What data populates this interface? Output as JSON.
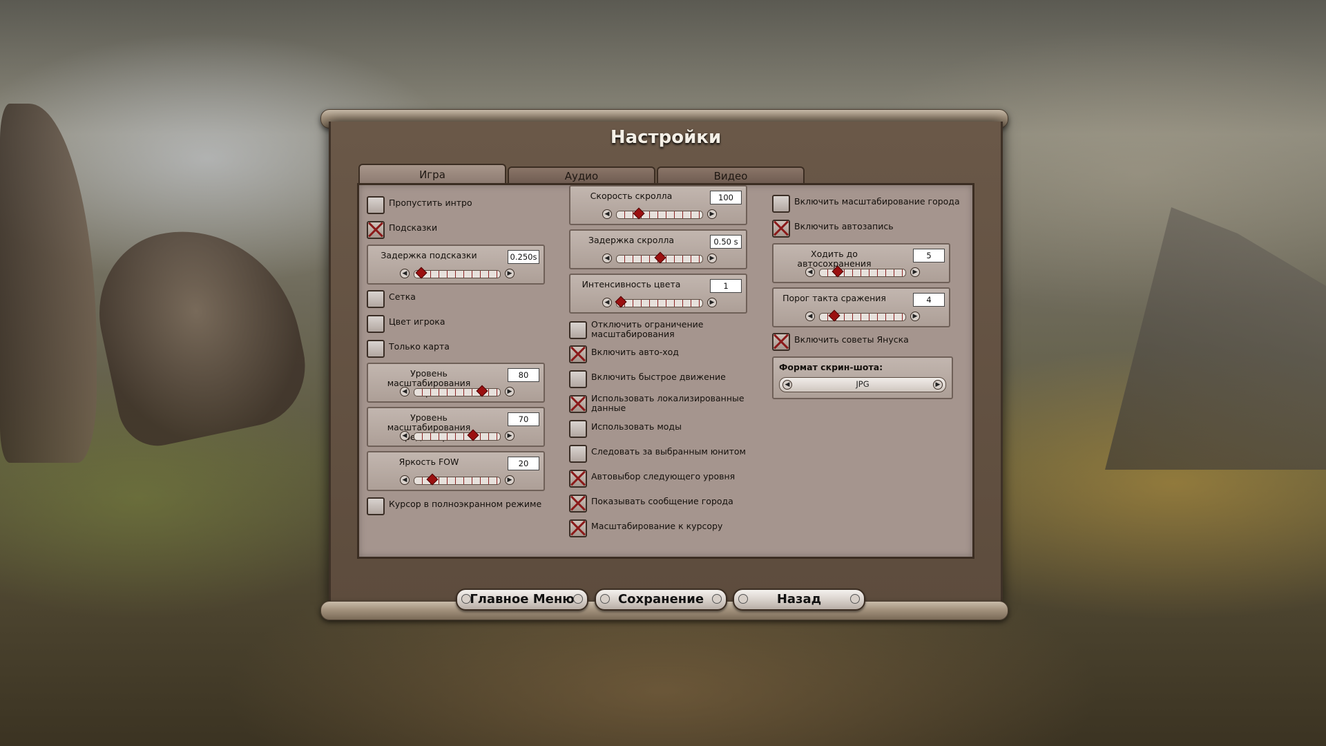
{
  "title": "Настройки",
  "tabs": [
    {
      "label": "Игра",
      "active": true
    },
    {
      "label": "Аудио",
      "active": false
    },
    {
      "label": "Видео",
      "active": false
    }
  ],
  "col1": {
    "skip_intro": {
      "label": "Пропустить интро",
      "checked": false
    },
    "hints": {
      "label": "Подсказки",
      "checked": true
    },
    "hint_delay": {
      "label": "Задержка подсказки",
      "value": "0.250s",
      "level": 0.07
    },
    "grid": {
      "label": "Сетка",
      "checked": false
    },
    "player_color": {
      "label": "Цвет игрока",
      "checked": false
    },
    "map_only": {
      "label": "Только карта",
      "checked": false
    },
    "map_zoom": {
      "label": "Уровень масштабирования карты",
      "value": "80",
      "level": 0.78
    },
    "editor_zoom": {
      "label": "Уровень масштабирования редактора",
      "value": "70",
      "level": 0.68
    },
    "fow_brightness": {
      "label": "Яркость FOW",
      "value": "20",
      "level": 0.2
    },
    "fullscreen_cursor": {
      "label": "Курсор в полноэкранном режиме",
      "checked": false
    }
  },
  "col2": {
    "scroll_speed": {
      "label": "Скорость скролла",
      "value": "100",
      "level": 0.25
    },
    "scroll_delay": {
      "label": "Задержка скролла",
      "value": "0.50 s",
      "level": 0.5
    },
    "color_intensity": {
      "label": "Интенсивность цвета",
      "value": "1",
      "level": 0.04
    },
    "disable_zoom_limit": {
      "label": "Отключить ограничение масштабирования",
      "checked": false
    },
    "auto_move": {
      "label": "Включить авто-ход",
      "checked": true
    },
    "fast_move": {
      "label": "Включить быстрое движение",
      "checked": false
    },
    "localized_data": {
      "label": "Использовать локализированные данные",
      "checked": true
    },
    "use_mods": {
      "label": "Использовать моды",
      "checked": false
    },
    "follow_unit": {
      "label": "Следовать за выбранным юнитом",
      "checked": false
    },
    "auto_next_level": {
      "label": "Автовыбор следующего уровня",
      "checked": true
    },
    "city_message": {
      "label": "Показывать сообщение города",
      "checked": true
    },
    "zoom_to_cursor": {
      "label": "Масштабирование к курсору",
      "checked": true
    }
  },
  "col3": {
    "city_zoom": {
      "label": "Включить масштабирование города",
      "checked": false
    },
    "autosave": {
      "label": "Включить автозапись",
      "checked": true
    },
    "autosave_turns": {
      "label": "Ходить до автосохранения",
      "value": "5",
      "level": 0.2
    },
    "battle_tick": {
      "label": "Порог такта сражения",
      "value": "4",
      "level": 0.16
    },
    "janus_tips": {
      "label": "Включить советы Януска",
      "checked": true
    },
    "screenshot_format": {
      "label": "Формат скрин-шота:",
      "value": "JPG"
    }
  },
  "buttons": {
    "main_menu": "Главное Меню",
    "save": "Сохранение",
    "back": "Назад"
  },
  "colors": {
    "panel": "#a5958e",
    "accent_red": "#9b1010",
    "frame": "#5d4c3d"
  }
}
